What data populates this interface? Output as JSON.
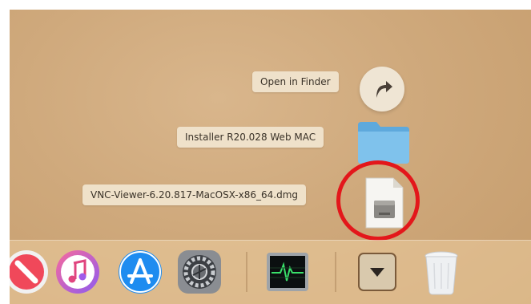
{
  "stack": {
    "open_in_finder": "Open in Finder",
    "items": [
      {
        "label": "Installer R20.028 Web MAC",
        "icon": "folder-icon"
      },
      {
        "label": "VNC-Viewer-6.20.817-MacOSX-x86_64.dmg",
        "icon": "dmg-file-icon"
      }
    ]
  },
  "dock": {
    "items": [
      "news-icon",
      "itunes-icon",
      "app-store-icon",
      "system-preferences-icon",
      "activity-monitor-icon",
      "downloads-stack-icon",
      "trash-icon"
    ]
  },
  "colors": {
    "highlight": "#e3171b",
    "folder": "#7fc2ec"
  }
}
